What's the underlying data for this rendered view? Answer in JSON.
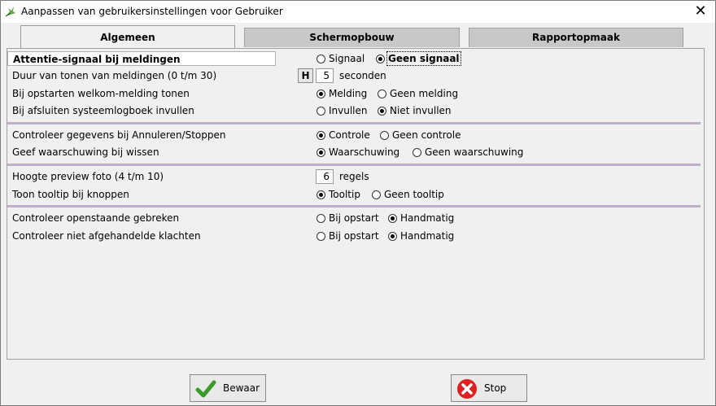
{
  "window": {
    "title": "Aanpassen van gebruikersinstellingen voor Gebruiker",
    "close": "✕"
  },
  "tabs": [
    {
      "label": "Algemeen"
    },
    {
      "label": "Schermopbouw"
    },
    {
      "label": "Rapportopmaak"
    }
  ],
  "settings": {
    "attentie": {
      "label": "Attentie-signaal bij meldingen",
      "opt1": "Signaal",
      "opt2": "Geen signaal",
      "selected": 2
    },
    "duur": {
      "label": "Duur van tonen van meldingen (0 t/m 30)",
      "h_button": "H",
      "value": "5",
      "unit": "seconden"
    },
    "welkom": {
      "label": "Bij opstarten welkom-melding tonen",
      "opt1": "Melding",
      "opt2": "Geen melding",
      "selected": 1
    },
    "logboek": {
      "label": "Bij afsluiten systeemlogboek invullen",
      "opt1": "Invullen",
      "opt2": "Niet invullen",
      "selected": 2
    },
    "controle": {
      "label": "Controleer gegevens bij Annuleren/Stoppen",
      "opt1": "Controle",
      "opt2": "Geen controle",
      "selected": 1
    },
    "wissen": {
      "label": "Geef waarschuwing bij wissen",
      "opt1": "Waarschuwing",
      "opt2": "Geen waarschuwing",
      "selected": 1
    },
    "preview": {
      "label": "Hoogte preview foto (4 t/m 10)",
      "value": "6",
      "unit": "regels"
    },
    "tooltip": {
      "label": "Toon tooltip bij knoppen",
      "opt1": "Tooltip",
      "opt2": "Geen tooltip",
      "selected": 1
    },
    "gebreken": {
      "label": "Controleer openstaande gebreken",
      "opt1": "Bij opstart",
      "opt2": "Handmatig",
      "selected": 2
    },
    "klachten": {
      "label": "Controleer niet afgehandelde klachten",
      "opt1": "Bij opstart",
      "opt2": "Handmatig",
      "selected": 2
    }
  },
  "buttons": {
    "save": "Bewaar",
    "stop": "Stop"
  },
  "colors": {
    "separator": "#c0afc8",
    "save_check": "#3a9a2a",
    "stop_red": "#e02020"
  }
}
